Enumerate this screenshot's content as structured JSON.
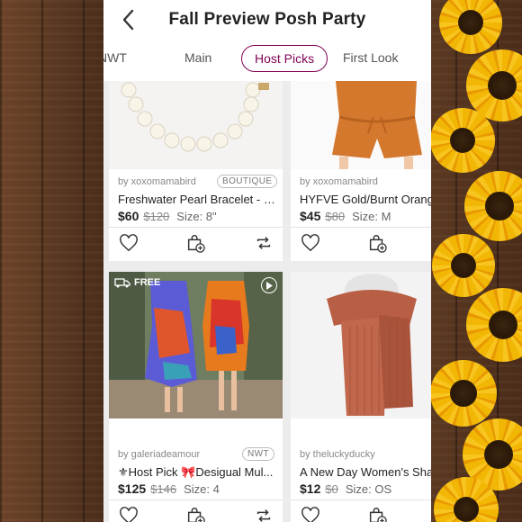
{
  "header": {
    "title": "Fall Preview Posh Party"
  },
  "tabs": [
    {
      "label": "NWT"
    },
    {
      "label": "Main"
    },
    {
      "label": "Host Picks",
      "active": true
    },
    {
      "label": "First Look"
    }
  ],
  "colors": {
    "accent": "#7f0353",
    "background_wood": "#5a3a24",
    "sunflower": "#f2b705"
  },
  "listings": [
    {
      "seller": "by xoxomamabird",
      "badge": "BOUTIQUE",
      "title": "Freshwater Pearl Bracelet - H...",
      "price": "$60",
      "original_price": "$120",
      "size": "Size: 8\"",
      "image": "pearl-bracelet"
    },
    {
      "seller": "by xoxomamabird",
      "badge": "",
      "title": "HYFVE Gold/Burnt Orang",
      "price": "$45",
      "original_price": "$80",
      "size": "Size: M",
      "image": "orange-romper"
    },
    {
      "seller": "by galeriadeamour",
      "badge": "NWT",
      "title": "⚜Host Pick 🎀Desigual Mul...",
      "price": "$125",
      "original_price": "$146",
      "size": "Size: 4",
      "free_label": "FREE",
      "image": "desigual-dress"
    },
    {
      "seller": "by theluckyducky",
      "badge": "",
      "title": "A New Day Women's Shak",
      "price": "$12",
      "original_price": "$0",
      "size": "Size: OS",
      "image": "rust-scarf"
    }
  ],
  "icons": {
    "back": "chevron-left-icon",
    "like": "heart-icon",
    "bundle": "bag-plus-icon",
    "share": "share-arrows-icon",
    "shipping": "truck-icon",
    "video": "play-icon"
  }
}
